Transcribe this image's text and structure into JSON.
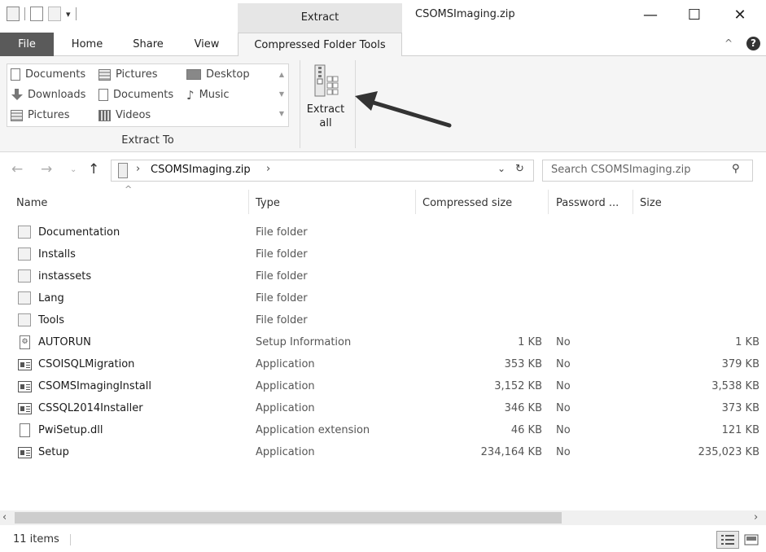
{
  "window": {
    "title": "CSOMSImaging.zip",
    "context_tab": "Extract",
    "minimize": "—",
    "maximize": "☐",
    "close": "✕"
  },
  "ribbon": {
    "tabs": [
      "File",
      "Home",
      "Share",
      "View",
      "Compressed Folder Tools"
    ],
    "extract_to": {
      "destinations": [
        [
          "Documents",
          "Pictures",
          "Desktop"
        ],
        [
          "Downloads",
          "Documents",
          "Music"
        ],
        [
          "Pictures",
          "Videos"
        ]
      ],
      "group_label": "Extract To"
    },
    "extract_all": {
      "line1": "Extract",
      "line2": "all"
    }
  },
  "address": {
    "path": "CSOMSImaging.zip",
    "separator": "›",
    "search_placeholder": "Search CSOMSImaging.zip"
  },
  "columns": [
    "Name",
    "Type",
    "Compressed size",
    "Password ...",
    "Size"
  ],
  "files": [
    {
      "name": "Documentation",
      "icon": "folder-icon",
      "type": "File folder",
      "compressed": "",
      "password": "",
      "size": ""
    },
    {
      "name": "Installs",
      "icon": "folder-icon",
      "type": "File folder",
      "compressed": "",
      "password": "",
      "size": ""
    },
    {
      "name": "instassets",
      "icon": "folder-icon",
      "type": "File folder",
      "compressed": "",
      "password": "",
      "size": ""
    },
    {
      "name": "Lang",
      "icon": "folder-icon",
      "type": "File folder",
      "compressed": "",
      "password": "",
      "size": ""
    },
    {
      "name": "Tools",
      "icon": "folder-icon",
      "type": "File folder",
      "compressed": "",
      "password": "",
      "size": ""
    },
    {
      "name": "AUTORUN",
      "icon": "setup-info-icon",
      "type": "Setup Information",
      "compressed": "1 KB",
      "password": "No",
      "size": "1 KB"
    },
    {
      "name": "CSOISQLMigration",
      "icon": "application-icon",
      "type": "Application",
      "compressed": "353 KB",
      "password": "No",
      "size": "379 KB"
    },
    {
      "name": "CSOMSImagingInstall",
      "icon": "application-icon",
      "type": "Application",
      "compressed": "3,152 KB",
      "password": "No",
      "size": "3,538 KB"
    },
    {
      "name": "CSSQL2014Installer",
      "icon": "application-icon",
      "type": "Application",
      "compressed": "346 KB",
      "password": "No",
      "size": "373 KB"
    },
    {
      "name": "PwiSetup.dll",
      "icon": "dll-file-icon",
      "type": "Application extension",
      "compressed": "46 KB",
      "password": "No",
      "size": "121 KB"
    },
    {
      "name": "Setup",
      "icon": "application-icon",
      "type": "Application",
      "compressed": "234,164 KB",
      "password": "No",
      "size": "235,023 KB"
    }
  ],
  "status": {
    "item_count": "11 items"
  },
  "colors": {
    "file_tab": "#5a5a5a",
    "context_tab": "#e6e6e6",
    "ribbon_bg": "#f5f5f5",
    "arrow": "#333333"
  }
}
